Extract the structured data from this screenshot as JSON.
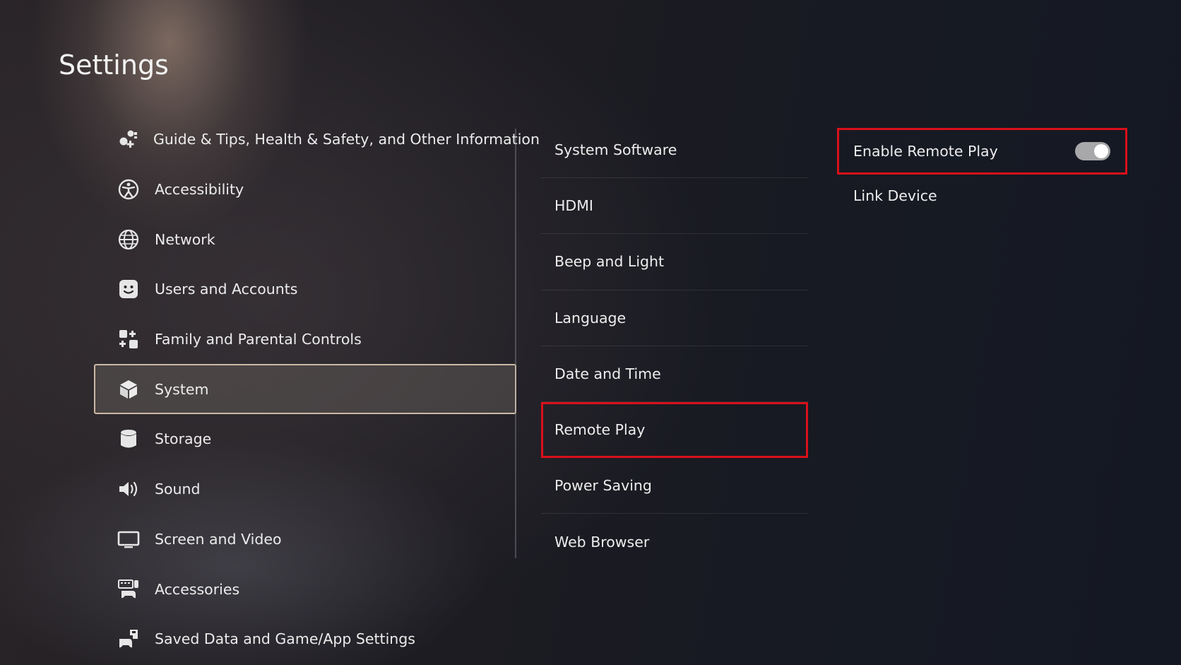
{
  "page": {
    "title": "Settings"
  },
  "main_menu": {
    "items": [
      {
        "label": "Guide & Tips, Health & Safety, and Other Information",
        "icon": "guide-icon"
      },
      {
        "label": "Accessibility",
        "icon": "accessibility-icon"
      },
      {
        "label": "Network",
        "icon": "globe-icon"
      },
      {
        "label": "Users and Accounts",
        "icon": "smiley-face-icon"
      },
      {
        "label": "Family and Parental Controls",
        "icon": "family-icon"
      },
      {
        "label": "System",
        "icon": "cube-icon",
        "selected": true
      },
      {
        "label": "Storage",
        "icon": "storage-cylinder-icon"
      },
      {
        "label": "Sound",
        "icon": "speaker-icon"
      },
      {
        "label": "Screen and Video",
        "icon": "monitor-icon"
      },
      {
        "label": "Accessories",
        "icon": "keyboard-controller-icon"
      },
      {
        "label": "Saved Data and Game/App Settings",
        "icon": "controller-save-icon"
      }
    ]
  },
  "system_menu": {
    "items": [
      {
        "label": "System Software"
      },
      {
        "label": "HDMI"
      },
      {
        "label": "Beep and Light"
      },
      {
        "label": "Language"
      },
      {
        "label": "Date and Time"
      },
      {
        "label": "Remote Play",
        "highlighted": true
      },
      {
        "label": "Power Saving"
      },
      {
        "label": "Web Browser"
      }
    ]
  },
  "remote_play": {
    "enable_label": "Enable Remote Play",
    "enable_state": "on",
    "link_device_label": "Link Device"
  },
  "colors": {
    "highlight_outline": "#d9101a",
    "selected_border": "#cbb9a4",
    "toggle_on": "#a8a8ab"
  }
}
